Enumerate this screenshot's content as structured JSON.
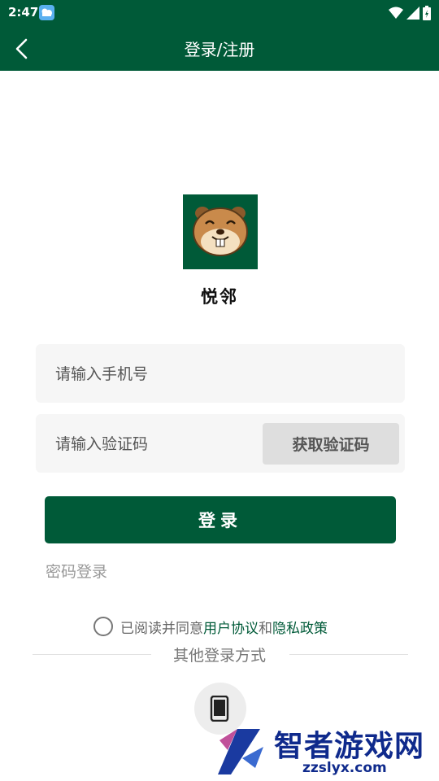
{
  "status_bar": {
    "time": "2:47",
    "icons": [
      "photos-app-icon",
      "wifi-icon",
      "signal-icon",
      "battery-icon"
    ]
  },
  "header": {
    "title": "登录/注册",
    "back_icon": "chevron-left-icon"
  },
  "app": {
    "name": "悦邻",
    "logo": "squirrel-mascot-logo"
  },
  "form": {
    "phone_placeholder": "请输入手机号",
    "code_placeholder": "请输入验证码",
    "get_code_label": "获取验证码",
    "login_label": "登录",
    "password_login_label": "密码登录"
  },
  "agreement": {
    "prefix": "已阅读并同意",
    "user_agreement": "用户协议",
    "conjunction": "和",
    "privacy_policy": "隐私政策"
  },
  "other_login": {
    "label": "其他登录方式",
    "phone_icon": "phone-icon"
  },
  "watermark": {
    "brand": "智者游戏网",
    "url": "zzslyx.com"
  },
  "colors": {
    "primary": "#005a38",
    "field_bg": "#f6f6f6",
    "muted_text": "#999999"
  }
}
